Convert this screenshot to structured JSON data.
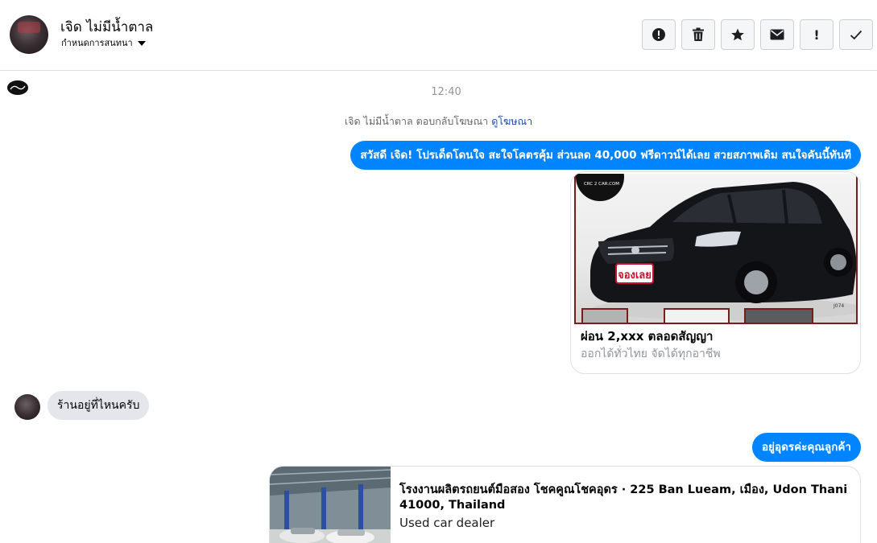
{
  "header": {
    "name": "เจิด ไม่มีน้ำตาล",
    "subtitle": "กำหนดการสนทนา",
    "actions": [
      {
        "name": "report-icon"
      },
      {
        "name": "trash-icon"
      },
      {
        "name": "star-icon"
      },
      {
        "name": "envelope-icon"
      },
      {
        "name": "exclamation-icon",
        "label": "!"
      },
      {
        "name": "check-icon"
      }
    ]
  },
  "conversation": {
    "timestamp": "12:40",
    "ad_reply_text": "เจิด ไม่มีน้ำตาล ตอบกลับโฆษณา",
    "ad_reply_link": "ดูโฆษณา",
    "messages": [
      {
        "direction": "out",
        "text": "สวัสดี เจิด! โปรเด็ดโดนใจ สะใจโคตรคุ้ม ส่วนลด 40,000 ฟรีดาวน์ได้เลย สวยสภาพเดิม สนใจคันนี้ทันที"
      },
      {
        "direction": "in",
        "text": "ร้านอยู่ที่ไหนครับ"
      },
      {
        "direction": "out",
        "text": "อยู่อุดรค่ะคุณลูกค้า"
      }
    ],
    "ad_card": {
      "title": "ผ่อน 2,xxx ตลอดสัญญา",
      "description": "ออกได้ทั่วไทย จัดได้ทุกอาชีพ",
      "image_watermark": "CRC 2 CAR.COM",
      "image_badge": "จองเลย",
      "image_code": "J074"
    },
    "location_card": {
      "title": "โรงงานผลิตรถยนต์มือสอง โชคคูณโชคอุดร · 225 Ban Lueam, เมือง, Udon Thani 41000, Thailand",
      "subtitle": "Used car dealer"
    }
  },
  "colors": {
    "accent": "#0084ff",
    "incoming_bubble": "#e4e6eb",
    "link": "#1f4fa8",
    "muted": "#90949c"
  }
}
